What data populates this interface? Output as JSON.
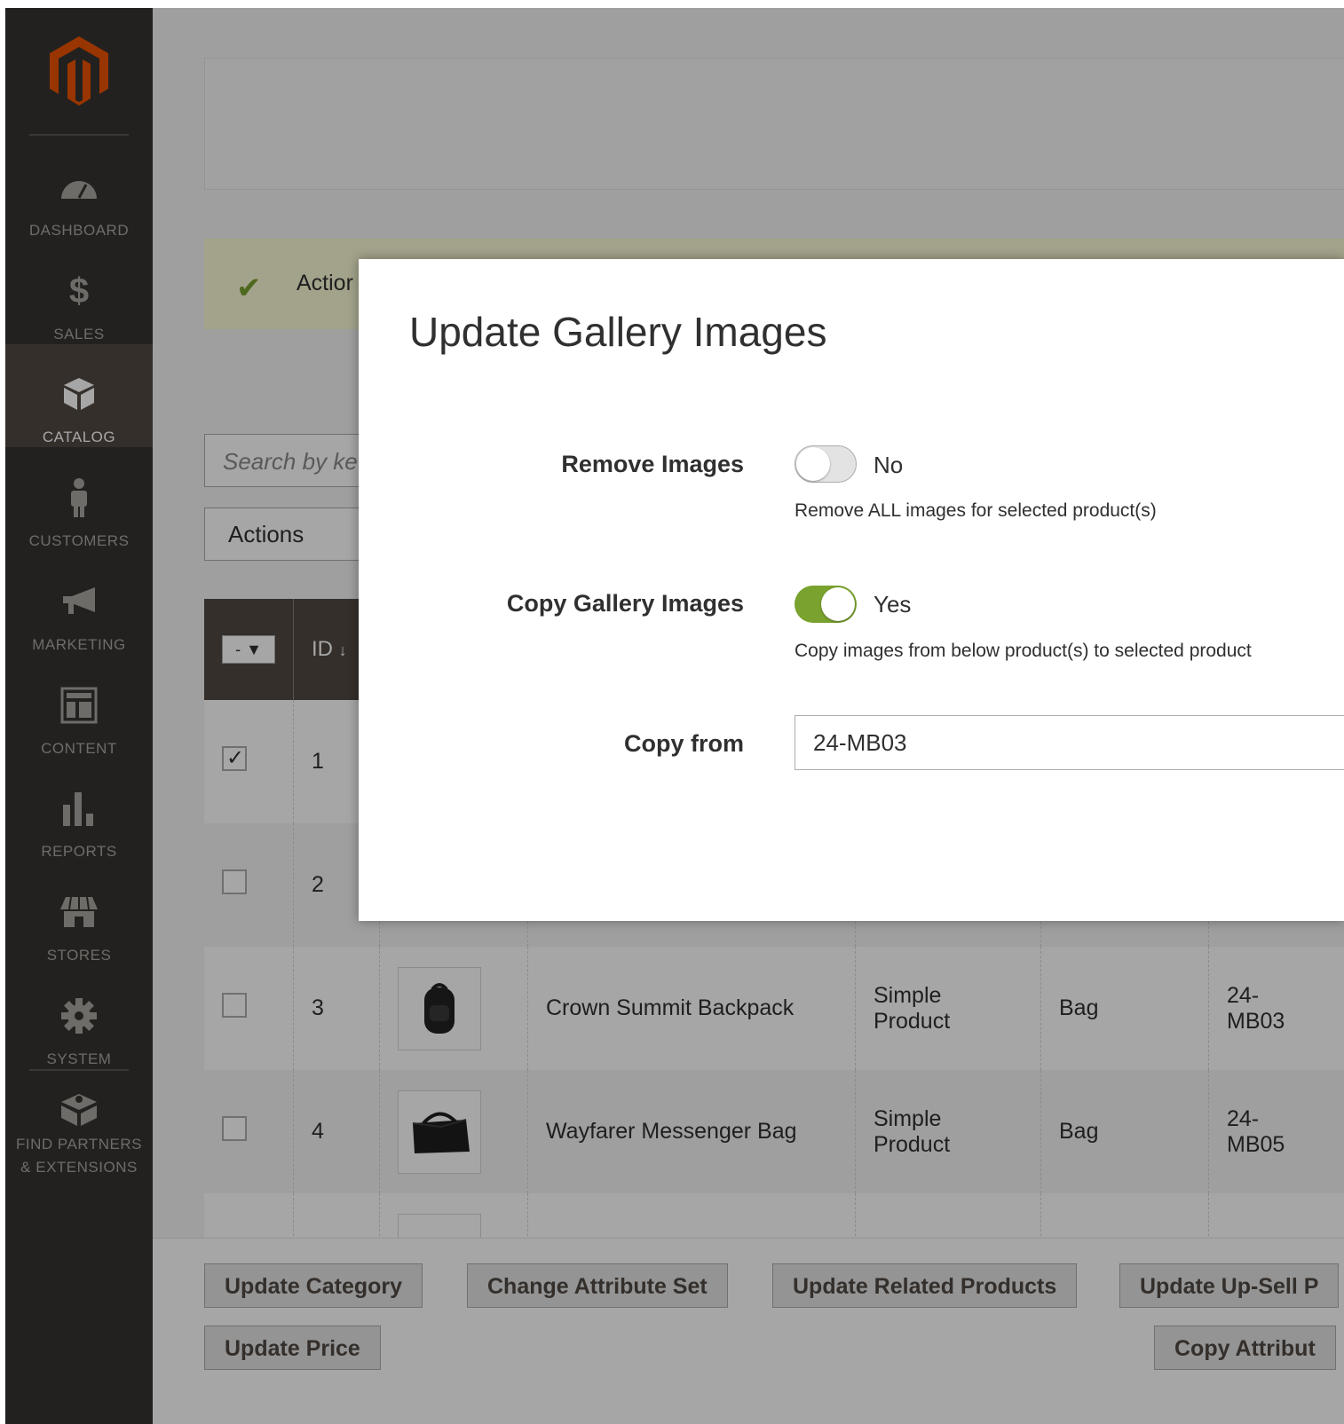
{
  "sidebar": {
    "items": [
      {
        "label": "DASHBOARD",
        "icon": "dashboard-icon"
      },
      {
        "label": "SALES",
        "icon": "dollar-icon"
      },
      {
        "label": "CATALOG",
        "icon": "cube-icon"
      },
      {
        "label": "CUSTOMERS",
        "icon": "person-icon"
      },
      {
        "label": "MARKETING",
        "icon": "megaphone-icon"
      },
      {
        "label": "CONTENT",
        "icon": "layout-icon"
      },
      {
        "label": "REPORTS",
        "icon": "bar-chart-icon"
      },
      {
        "label": "STORES",
        "icon": "storefront-icon"
      },
      {
        "label": "SYSTEM",
        "icon": "gear-icon"
      },
      {
        "label_line1": "FIND PARTNERS",
        "label_line2": "& EXTENSIONS",
        "icon": "extensions-icon"
      }
    ],
    "active": "CATALOG"
  },
  "page": {
    "message": "Actior",
    "search_placeholder": "Search by ke",
    "actions_label": "Actions",
    "grid": {
      "id_header": "ID",
      "rows": [
        {
          "checked": true,
          "id": "1",
          "name": "",
          "type_line1": "",
          "type_line2": "",
          "set": "",
          "sku_line1": "",
          "sku_line2": ""
        },
        {
          "checked": false,
          "id": "2",
          "name": "",
          "type_line1": "",
          "type_line2": "",
          "set": "",
          "sku_line1": "",
          "sku_line2": ""
        },
        {
          "checked": false,
          "id": "3",
          "name": "Crown Summit Backpack",
          "type_line1": "Simple",
          "type_line2": "Product",
          "set": "Bag",
          "sku_line1": "24-",
          "sku_line2": "MB03"
        },
        {
          "checked": false,
          "id": "4",
          "name": "Wayfarer Messenger Bag",
          "type_line1": "Simple",
          "type_line2": "Product",
          "set": "Bag",
          "sku_line1": "24-",
          "sku_line2": "MB05"
        }
      ]
    },
    "buttons": {
      "update_category": "Update Category",
      "change_attribute_set": "Change Attribute Set",
      "update_related_products": "Update Related Products",
      "update_upsell": "Update Up-Sell P",
      "update_price": "Update Price",
      "copy_attributes": "Copy Attribut"
    }
  },
  "modal": {
    "title": "Update Gallery Images",
    "remove_images": {
      "label": "Remove Images",
      "value": "No",
      "on": false,
      "note": "Remove ALL images for selected product(s)"
    },
    "copy_gallery": {
      "label": "Copy Gallery Images",
      "value": "Yes",
      "on": true,
      "note": "Copy images from below product(s) to selected product"
    },
    "copy_from": {
      "label": "Copy from",
      "value": "24-MB03"
    }
  },
  "colors": {
    "sidebar_bg": "#373330",
    "accent_orange": "#eb5202",
    "toggle_on": "#79a22e"
  }
}
